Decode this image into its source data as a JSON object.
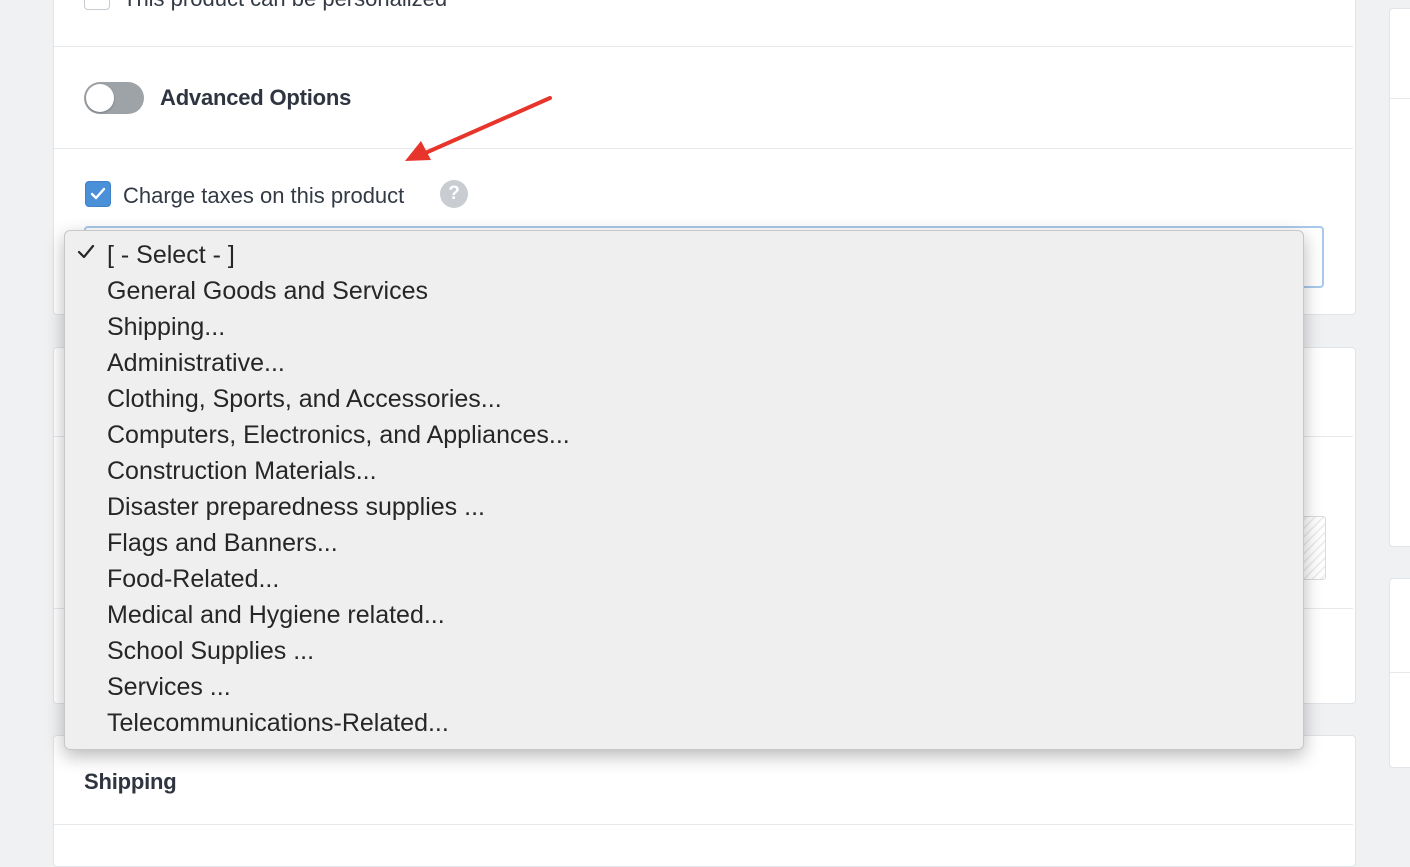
{
  "form": {
    "personalize_label": "This product can be personalized",
    "advanced_options_label": "Advanced Options",
    "advanced_options_enabled": false,
    "charge_taxes_label": "Charge taxes on this product",
    "charge_taxes_checked": true,
    "help_icon_glyph": "?"
  },
  "tax_category_dropdown": {
    "selected": "[ - Select - ]",
    "options": [
      "[ - Select - ]",
      "General Goods and Services",
      "Shipping...",
      "Administrative...",
      "Clothing, Sports, and Accessories...",
      "Computers, Electronics, and Appliances...",
      "Construction Materials...",
      "Disaster preparedness supplies ...",
      "Flags and Banners...",
      "Food-Related...",
      "Medical and Hygiene related...",
      "School Supplies ...",
      "Services ...",
      "Telecommunications-Related..."
    ]
  },
  "shipping_section": {
    "title": "Shipping"
  },
  "colors": {
    "accent": "#4a90d9",
    "annotation_arrow": "#e8352b"
  },
  "icons": {
    "check": "check-icon",
    "help": "question-circle-icon",
    "annotation": "red-arrow-icon"
  }
}
